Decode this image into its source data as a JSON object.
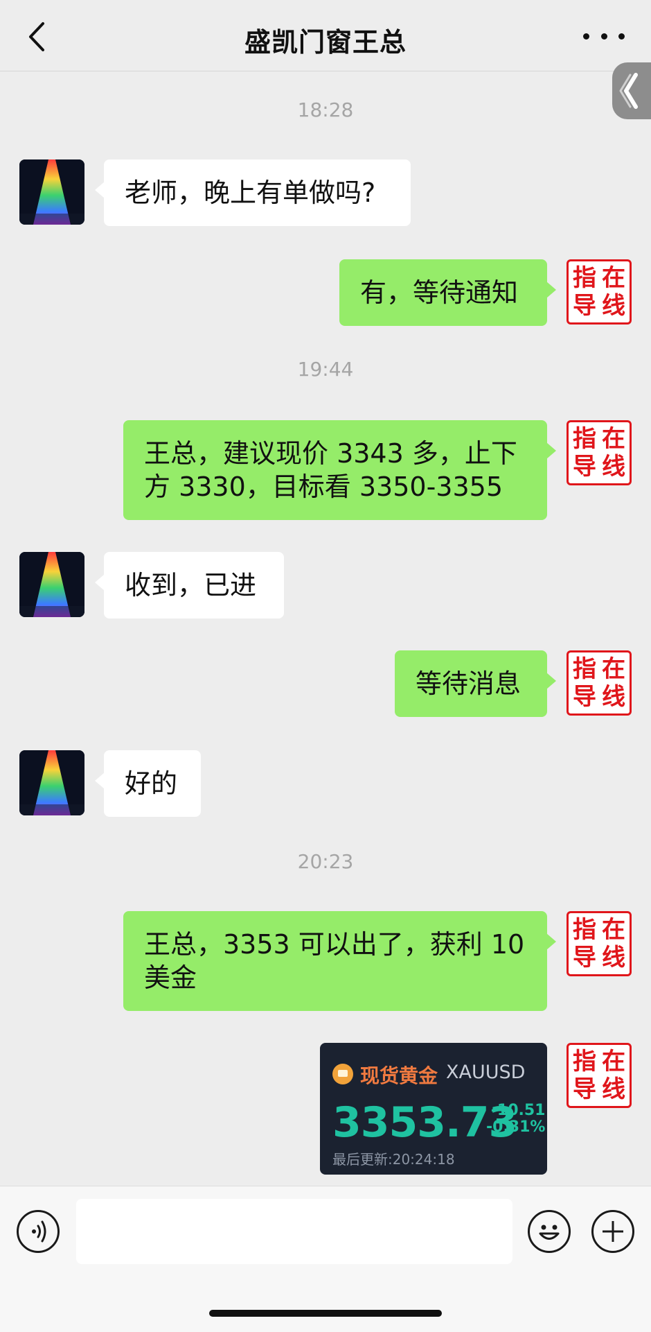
{
  "header": {
    "title": "盛凯门窗王总",
    "back_icon": "chevron-left-icon",
    "more_icon": "more-dots-icon"
  },
  "timestamps": [
    "18:28",
    "19:44",
    "20:23"
  ],
  "messages": [
    {
      "side": "in",
      "text": "老师，晚上有单做吗?"
    },
    {
      "side": "out",
      "text": "有，等待通知"
    },
    {
      "side": "out",
      "text": "王总，建议现价 3343 多，止下方 3330，目标看 3350-3355"
    },
    {
      "side": "in",
      "text": "收到，已进"
    },
    {
      "side": "out",
      "text": "等待消息"
    },
    {
      "side": "in",
      "text": "好的"
    },
    {
      "side": "out",
      "text": "王总，3353 可以出了，获利 10 美金"
    },
    {
      "side": "out",
      "type": "image-card"
    }
  ],
  "self_avatar": {
    "chars": [
      "指",
      "在",
      "导",
      "线"
    ],
    "color": "#e0161b"
  },
  "gold_card": {
    "name": "现货黄金",
    "symbol": "XAUUSD",
    "price": "3353.73",
    "change": "-10.51",
    "change_pct": "-0.31%",
    "updated": "最后更新:20:24:18",
    "accent": "#1fc2a1",
    "name_color": "#f07a40"
  },
  "input_bar": {
    "voice_icon": "voice-icon",
    "emoji_icon": "emoji-icon",
    "plus_icon": "plus-icon",
    "text": ""
  },
  "colors": {
    "background": "#ededed",
    "bubble_out": "#95ec69",
    "bubble_in": "#ffffff"
  }
}
